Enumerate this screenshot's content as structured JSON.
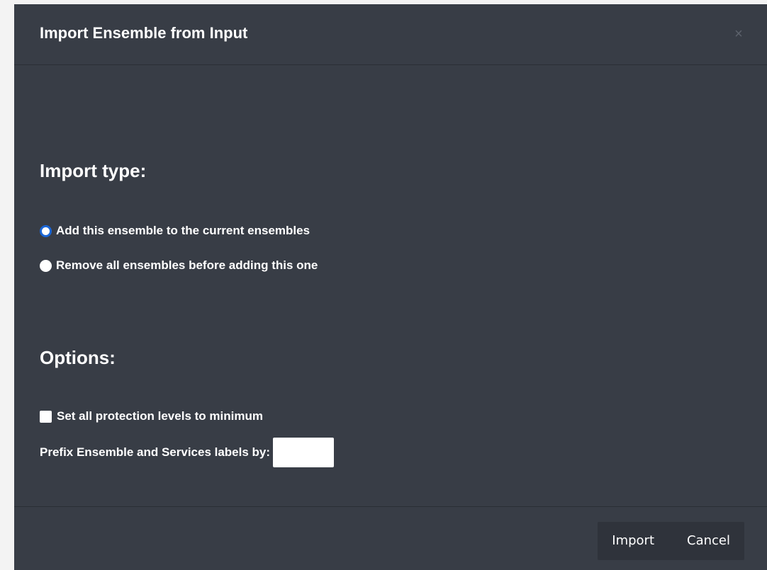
{
  "modal": {
    "title": "Import Ensemble from Input",
    "close_glyph": "×"
  },
  "import_type": {
    "heading": "Import type:",
    "options": [
      {
        "label": "Add this ensemble to the current ensembles",
        "selected": true
      },
      {
        "label": "Remove all ensembles before adding this one",
        "selected": false
      }
    ]
  },
  "options": {
    "heading": "Options:",
    "protection_minimum": {
      "label": "Set all protection levels to minimum",
      "checked": false
    },
    "prefix": {
      "label": "Prefix Ensemble and Services labels by:",
      "value": ""
    }
  },
  "footer": {
    "import_label": "Import",
    "cancel_label": "Cancel"
  },
  "colors": {
    "modal_bg": "#383d46",
    "button_group_bg": "#2f333b",
    "radio_accent": "#1a66d6"
  }
}
